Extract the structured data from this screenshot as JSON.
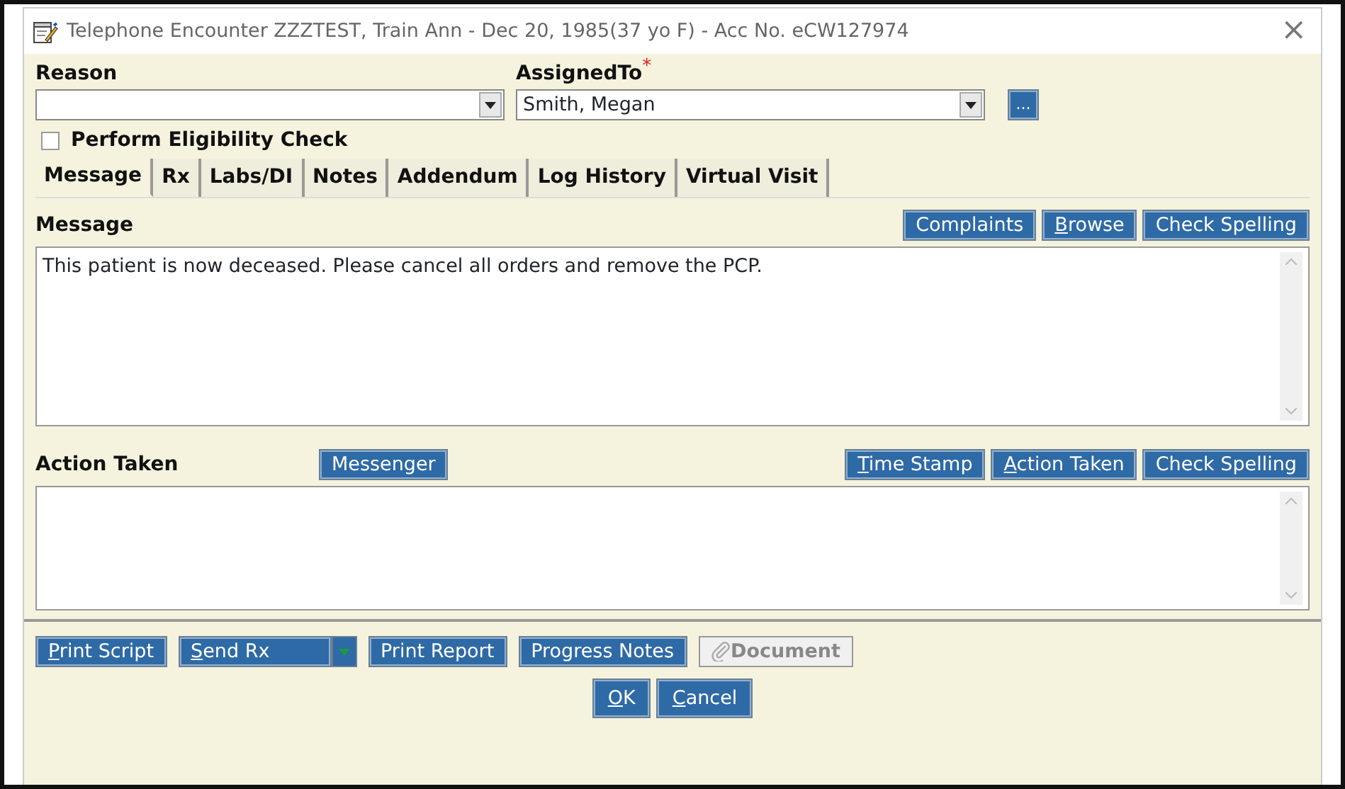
{
  "window": {
    "title": "Telephone Encounter ZZZTEST, Train Ann - Dec 20, 1985(37 yo F) - Acc No. eCW127974",
    "close": "×"
  },
  "reason": {
    "label": "Reason"
  },
  "assigned_to": {
    "label": "AssignedTo",
    "required_mark": "*",
    "value": "Smith, Megan",
    "browse_button": "..."
  },
  "eligibility": {
    "label": "Perform Eligibility Check",
    "checked": false
  },
  "tabs": [
    {
      "label": "Message",
      "selected": true
    },
    {
      "label": "Rx",
      "selected": false
    },
    {
      "label": "Labs/DI",
      "selected": false
    },
    {
      "label": "Notes",
      "selected": false
    },
    {
      "label": "Addendum",
      "selected": false
    },
    {
      "label": "Log History",
      "selected": false
    },
    {
      "label": "Virtual Visit",
      "selected": false
    }
  ],
  "message": {
    "label": "Message",
    "buttons": [
      {
        "label": "Complaints",
        "mnemonic": false
      },
      {
        "label": "Browse",
        "mnemonic": true
      },
      {
        "label": "Check Spelling",
        "mnemonic": false
      }
    ],
    "value": "This patient is now deceased. Please cancel all orders and remove the PCP."
  },
  "action_taken": {
    "label": "Action Taken",
    "messenger": "Messenger",
    "buttons": [
      {
        "label": "Time Stamp",
        "mnemonic": true
      },
      {
        "label": "Action Taken",
        "mnemonic": true
      },
      {
        "label": "Check Spelling",
        "mnemonic": false
      }
    ]
  },
  "footer_buttons": [
    {
      "label": "Print Script",
      "mnemonic": true,
      "disabled": false,
      "kind": "plain"
    },
    {
      "label": "Send Rx",
      "mnemonic": true,
      "disabled": false,
      "kind": "split"
    },
    {
      "label": "Print Report",
      "mnemonic": false,
      "disabled": false,
      "kind": "plain"
    },
    {
      "label": "Progress Notes",
      "mnemonic": false,
      "disabled": false,
      "kind": "plain"
    },
    {
      "label": "Document",
      "mnemonic": false,
      "disabled": true,
      "kind": "attach"
    }
  ],
  "dialog_buttons": [
    {
      "label": "OK",
      "mnemonic": true
    },
    {
      "label": "Cancel",
      "mnemonic": true
    }
  ]
}
